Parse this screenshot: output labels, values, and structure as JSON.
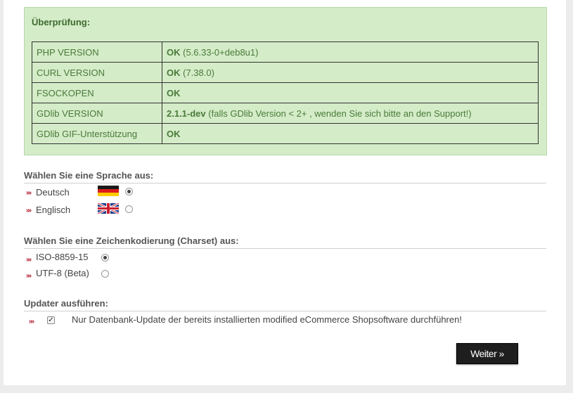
{
  "check": {
    "title": "Überprüfung:",
    "rows": [
      {
        "label": "PHP VERSION",
        "status": "OK",
        "detail": "(5.6.33-0+deb8u1)"
      },
      {
        "label": "CURL VERSION",
        "status": "OK",
        "detail": "(7.38.0)"
      },
      {
        "label": "FSOCKOPEN",
        "status": "OK",
        "detail": ""
      },
      {
        "label": "GDlib VERSION",
        "status": "2.1.1-dev",
        "detail": "(falls GDlib Version < 2+ , wenden Sie sich bitte an den Support!)"
      },
      {
        "label": "GDlib GIF-Unterstützung",
        "status": "OK",
        "detail": ""
      }
    ]
  },
  "language": {
    "title": "Wählen Sie eine Sprache aus:",
    "options": [
      {
        "label": "Deutsch",
        "flag": "german-flag",
        "selected": true
      },
      {
        "label": "Englisch",
        "flag": "uk-flag",
        "selected": false
      }
    ]
  },
  "charset": {
    "title": "Wählen Sie eine Zeichenkodierung (Charset) aus:",
    "options": [
      {
        "label": "ISO-8859-15",
        "selected": true
      },
      {
        "label": "UTF-8 (Beta)",
        "selected": false
      }
    ]
  },
  "updater": {
    "title": "Updater ausführen:",
    "checkbox_label": "Nur Datenbank-Update der bereits installierten modified eCommerce Shopsoftware durchführen!",
    "checked": true
  },
  "actions": {
    "next_label": "Weiter »"
  }
}
